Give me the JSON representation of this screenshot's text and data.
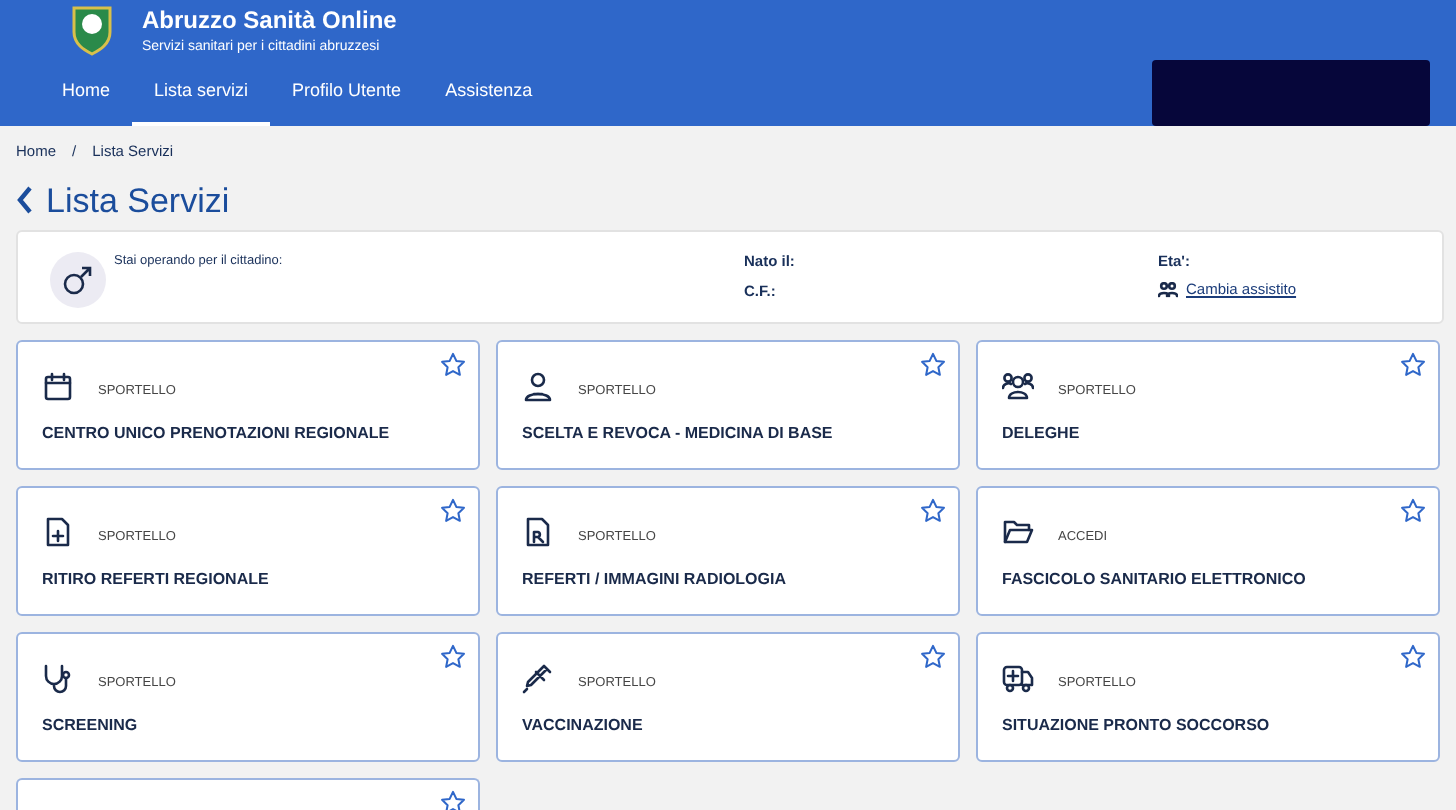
{
  "header": {
    "title": "Abruzzo Sanità Online",
    "subtitle": "Servizi sanitari per i cittadini abruzzesi"
  },
  "nav": [
    {
      "label": "Home",
      "selected": false
    },
    {
      "label": "Lista servizi",
      "selected": true
    },
    {
      "label": "Profilo Utente",
      "selected": false
    },
    {
      "label": "Assistenza",
      "selected": false
    }
  ],
  "breadcrumb": {
    "items": [
      "Home",
      "Lista Servizi"
    ],
    "separator": "/"
  },
  "page_title": "Lista Servizi",
  "citizen": {
    "intro": "Stai operando per il cittadino:",
    "born_label": "Nato il:",
    "cf_label": "C.F.:",
    "age_label": "Eta':",
    "change_link": "Cambia assistito"
  },
  "services": [
    {
      "category": "SPORTELLO",
      "title": "CENTRO UNICO PRENOTAZIONI REGIONALE",
      "favorite": false
    },
    {
      "category": "SPORTELLO",
      "title": "SCELTA E REVOCA - MEDICINA DI BASE",
      "favorite": false
    },
    {
      "category": "SPORTELLO",
      "title": "DELEGHE",
      "favorite": false
    },
    {
      "category": "SPORTELLO",
      "title": "RITIRO REFERTI REGIONALE",
      "favorite": false
    },
    {
      "category": "SPORTELLO",
      "title": "REFERTI / IMMAGINI RADIOLOGIA",
      "favorite": false
    },
    {
      "category": "ACCEDI",
      "title": "FASCICOLO SANITARIO ELETTRONICO",
      "favorite": false
    },
    {
      "category": "SPORTELLO",
      "title": "SCREENING",
      "favorite": false
    },
    {
      "category": "SPORTELLO",
      "title": "VACCINAZIONE",
      "favorite": false
    },
    {
      "category": "SPORTELLO",
      "title": "SITUAZIONE PRONTO SOCCORSO",
      "favorite": false
    },
    {
      "favorite": false
    }
  ]
}
